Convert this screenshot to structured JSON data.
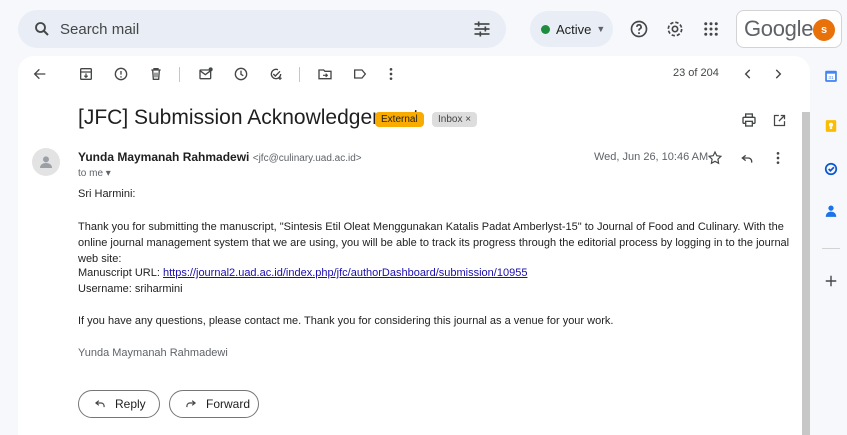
{
  "search": {
    "placeholder": "Search mail"
  },
  "status": {
    "label": "Active"
  },
  "brand": {
    "logo_text": "Google",
    "avatar_letter": "s"
  },
  "toolbar": {
    "pager": "23 of 204"
  },
  "email": {
    "subject": "[JFC] Submission Acknowledgement",
    "badge_external": "External",
    "badge_inbox": "Inbox ×",
    "sender_name": "Yunda Maymanah Rahmadewi",
    "sender_email": "<jfc@culinary.uad.ac.id>",
    "to": "to me ▾",
    "date": "Wed, Jun 26, 10:46 AM",
    "greeting": "Sri Harmini:",
    "para1": "Thank you for submitting the manuscript, \"Sintesis Etil Oleat Menggunakan Katalis Padat Amberlyst-15\" to Journal of Food and Culinary. With the online journal management system that we are using, you will be able to track its progress through the editorial process by logging in to the journal web site:",
    "url_label": "Manuscript URL: ",
    "url": "https://journal2.uad.ac.id/index.php/jfc/authorDashboard/submission/10955",
    "username": "Username: sriharmini",
    "para2": "If you have any questions, please contact me. Thank you for considering this journal as a venue for your work.",
    "signature": "Yunda Maymanah Rahmadewi"
  },
  "actions": {
    "reply": "Reply",
    "forward": "Forward"
  },
  "colors": {
    "accent_blue": "#0b57d0",
    "active_green": "#1e8e3e",
    "external_badge": "#f9ab00",
    "avatar": "#e8710a"
  },
  "icons": [
    "search-icon",
    "tune-icon",
    "help-icon",
    "settings-icon",
    "apps-icon",
    "back-arrow-icon",
    "archive-icon",
    "report-spam-icon",
    "delete-icon",
    "mark-unread-icon",
    "snooze-icon",
    "add-task-icon",
    "move-to-icon",
    "label-icon",
    "more-vert-icon",
    "chevron-left-icon",
    "chevron-right-icon",
    "print-icon",
    "open-new-window-icon",
    "star-icon",
    "reply-icon",
    "calendar-icon",
    "keep-icon",
    "tasks-icon",
    "contacts-icon",
    "add-icon"
  ]
}
